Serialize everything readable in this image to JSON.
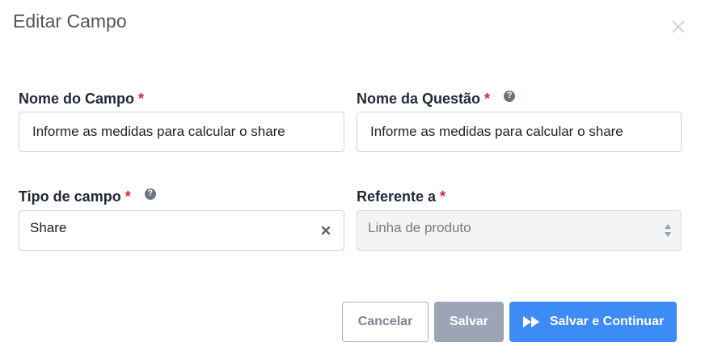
{
  "modal": {
    "title": "Editar Campo"
  },
  "form": {
    "nome_campo": {
      "label": "Nome do Campo",
      "required_mark": "*",
      "value": "Informe as medidas para calcular o share"
    },
    "nome_questao": {
      "label": "Nome da Questão",
      "required_mark": "*",
      "help_icon": "?",
      "value": "Informe as medidas para calcular o share"
    },
    "tipo_campo": {
      "label": "Tipo de campo",
      "required_mark": "*",
      "help_icon": "?",
      "value": "Share"
    },
    "referente_a": {
      "label": "Referente a",
      "required_mark": "*",
      "placeholder": "Linha de produto",
      "disabled": true
    }
  },
  "buttons": {
    "cancel": "Cancelar",
    "save": "Salvar",
    "save_continue": "Salvar e Continuar"
  },
  "colors": {
    "required": "#d9232d",
    "primary": "#3d8bf5",
    "save_disabled": "#9aa5b5"
  }
}
